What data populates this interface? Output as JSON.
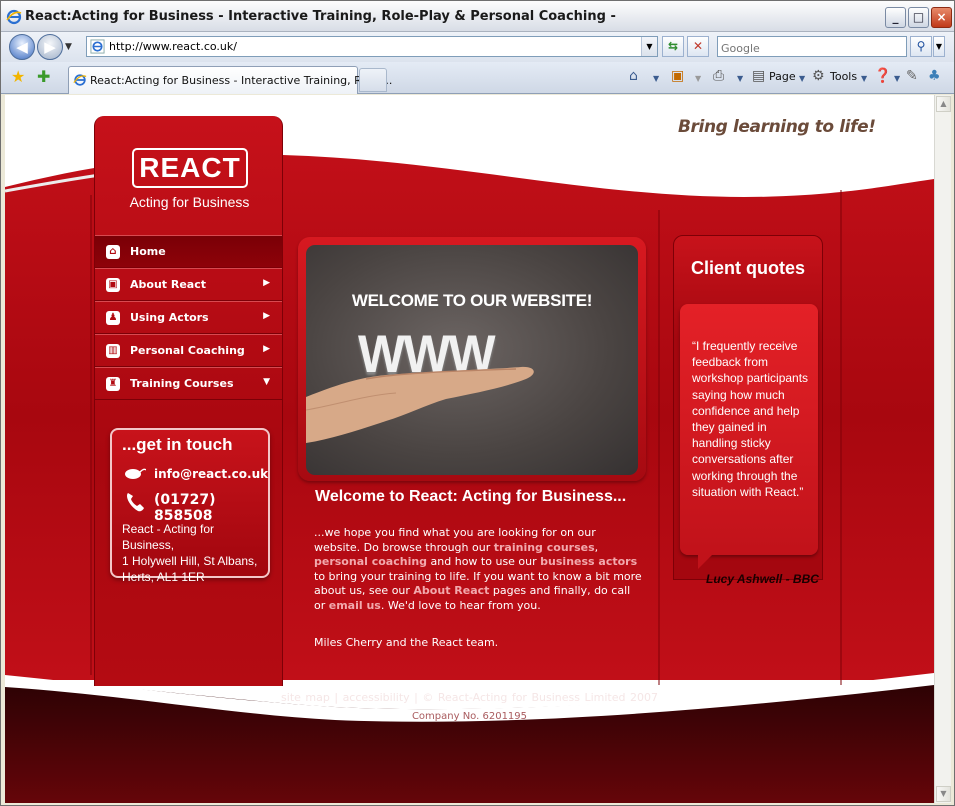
{
  "window": {
    "title": "React:Acting for Business - Interactive Training, Role-Play & Personal Coaching -",
    "controls": {
      "minimize": "_",
      "maximize": "□",
      "close": "×"
    }
  },
  "navbar": {
    "url": "http://www.react.co.uk/",
    "search_placeholder": "Google",
    "back_icon": "back-arrow-icon",
    "forward_icon": "forward-arrow-icon"
  },
  "tabbar": {
    "active_tab": "React:Acting for Business - Interactive Training, Role-...",
    "commands": {
      "page": "Page",
      "tools": "Tools"
    }
  },
  "site": {
    "tagline": "Bring learning to life!",
    "logo": {
      "text": "REACT",
      "subtitle": "Acting for Business"
    },
    "menu": [
      {
        "label": "Home",
        "icon": "home-icon",
        "arrow": ""
      },
      {
        "label": "About React",
        "icon": "about-icon",
        "arrow": "▶"
      },
      {
        "label": "Using Actors",
        "icon": "actors-icon",
        "arrow": "▶"
      },
      {
        "label": "Personal Coaching",
        "icon": "coaching-icon",
        "arrow": "▶"
      },
      {
        "label": "Training Courses",
        "icon": "courses-icon",
        "arrow": "▼"
      }
    ],
    "contact": {
      "title": "...get in touch",
      "email": "info@react.co.uk",
      "phone": "(01727) 858508",
      "address": [
        "React - Acting for Business,",
        "1 Holywell Hill,  St Albans,",
        "Herts, AL1 1ER"
      ]
    },
    "hero": {
      "headline": "WELCOME TO OUR WEBSITE!",
      "graphic_text": "WWW"
    },
    "welcome": {
      "title": "Welcome to React: Acting for Business...",
      "p1": "...we hope you find what you are looking for on our website. Do browse through our ",
      "link_training": "training courses",
      "p2": ", ",
      "link_coaching": "personal coaching",
      "p3": " and how to use our ",
      "link_actors": "business actors",
      "p4": " to bring your training to life. If you want to know a bit more about us, see our ",
      "link_about": "About React",
      "p5": " pages and finally, do call or ",
      "link_email": "email us",
      "p6": ". We'd love to hear from you.",
      "signoff": "Miles Cherry and the React team."
    },
    "quotes": {
      "title": "Client quotes",
      "text": "“I frequently receive feedback from workshop participants saying how much confidence and help they gained in handling sticky conversations after working through the situation with React.”",
      "author": "Lucy Ashwell - BBC"
    },
    "footer": {
      "sitemap": "site map",
      "sep1": "|",
      "accessibility": "accessibility",
      "sep2": "|",
      "copyright": "© React-Acting for Business Limited 2007",
      "company": "Company No. 6201195"
    }
  },
  "colors": {
    "brand_red": "#c8131b",
    "dark_red": "#8e0209",
    "link_pink": "#f2a9ad"
  }
}
